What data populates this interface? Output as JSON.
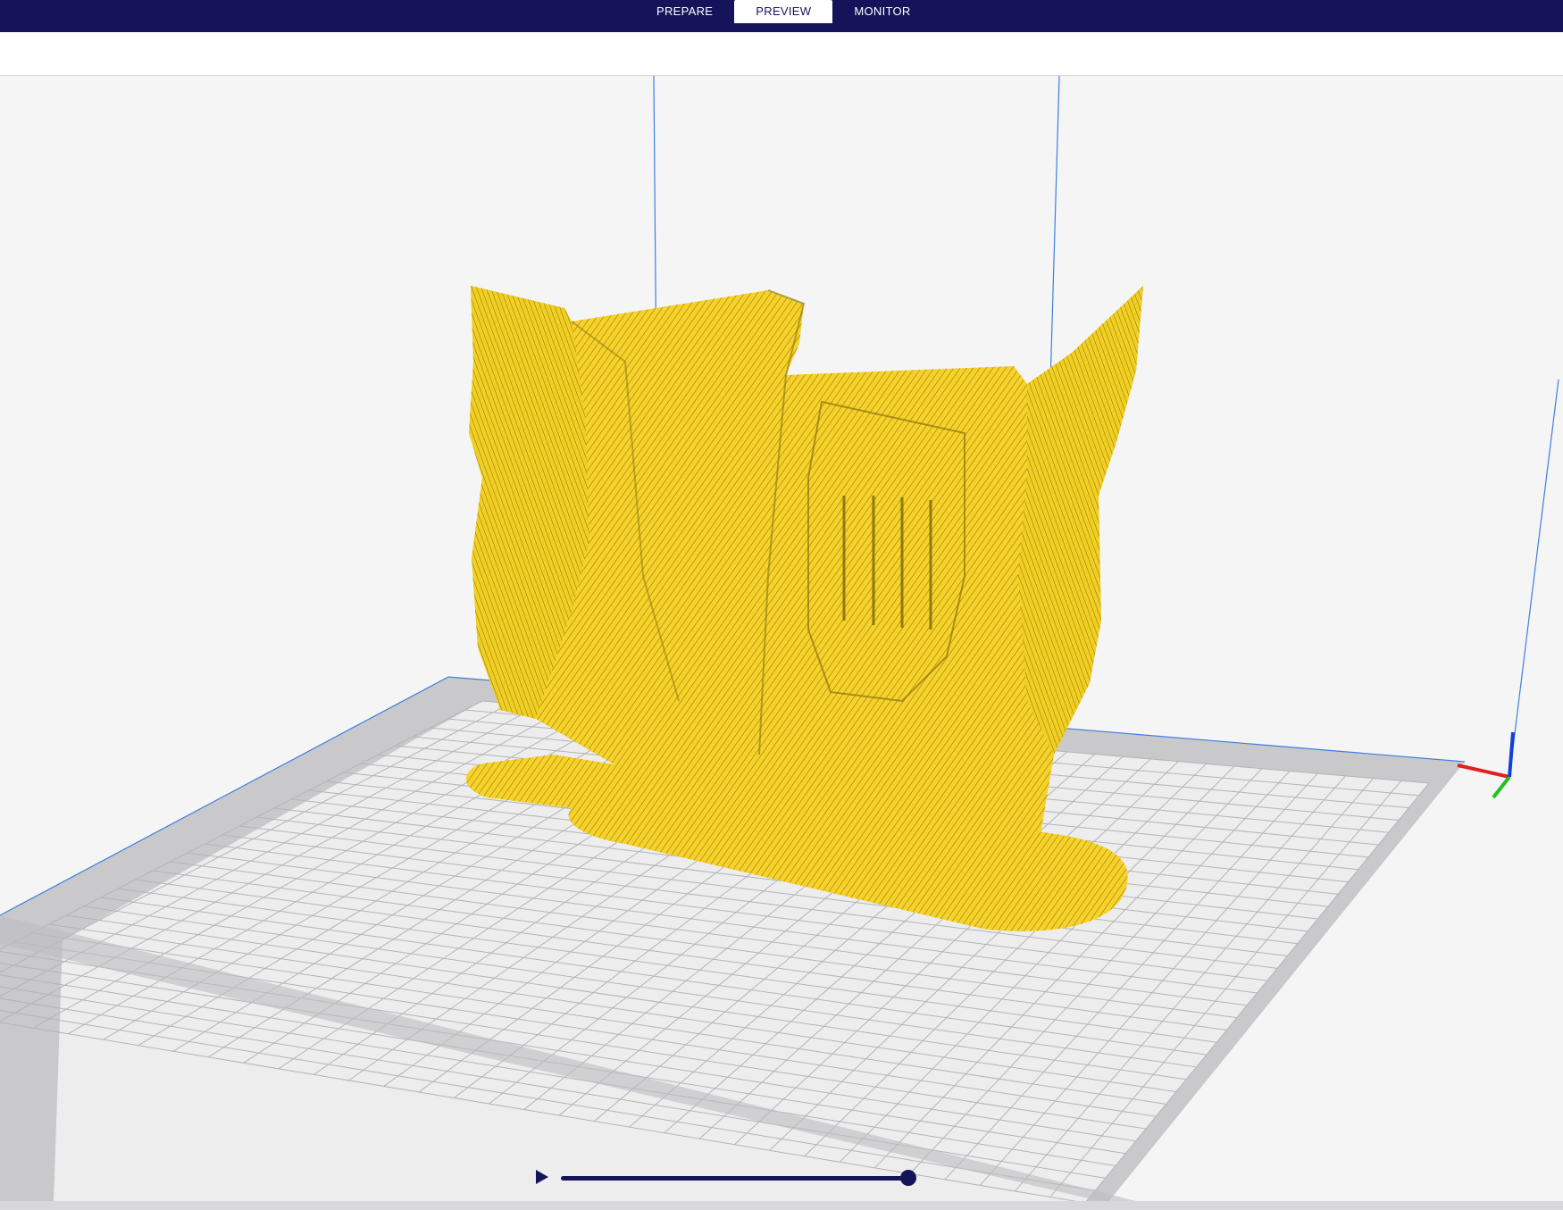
{
  "header": {
    "tabs": [
      {
        "label": "PREPARE",
        "active": false
      },
      {
        "label": "PREVIEW",
        "active": true
      },
      {
        "label": "MONITOR",
        "active": false
      }
    ]
  },
  "viewport": {
    "model_color": "#f6d22a",
    "bed_grid_color": "#b4b4b8",
    "build_volume_line_color": "#3d7fe0",
    "axis_colors": {
      "x": "#e02020",
      "y": "#20c020",
      "z": "#1040e0"
    }
  },
  "layer_slider": {
    "play_icon": "play-icon",
    "accent_color": "#15145a",
    "position": 1.0
  },
  "colors": {
    "header_bg": "#15145a",
    "tab_active_bg": "#ffffff"
  }
}
